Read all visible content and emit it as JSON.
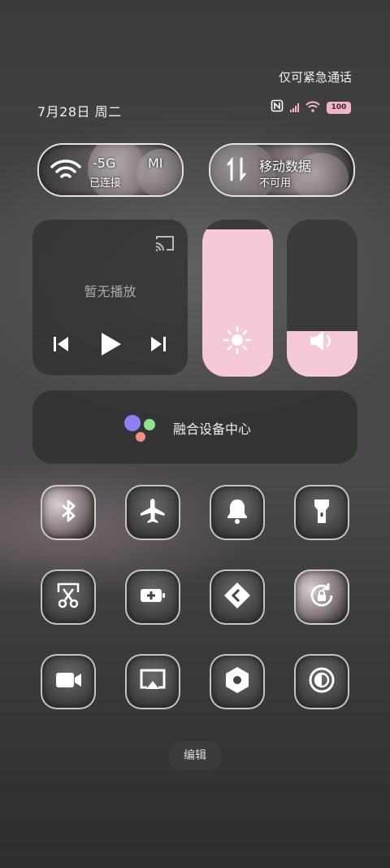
{
  "status_bar": {
    "emergency_text": "仅可紧急通话",
    "date_text": "7月28日 周二",
    "battery_level": "100",
    "accent_color": "#f2b4c8"
  },
  "connectivity": {
    "wifi": {
      "title": "-5G",
      "status": "已连接",
      "extra": "MI",
      "icon": "wifi-icon"
    },
    "mobile_data": {
      "title": "移动数据",
      "status": "不可用",
      "icon": "mobile-data-icon"
    }
  },
  "media": {
    "title": "暂无播放"
  },
  "sliders": {
    "brightness": {
      "level": 0.94,
      "icon": "brightness-icon",
      "color": "#f5c9d8"
    },
    "volume": {
      "level": 0.29,
      "icon": "volume-icon",
      "color": "#f5c9d8"
    }
  },
  "device_hub": {
    "label": "融合设备中心"
  },
  "toggles": [
    {
      "id": "bluetooth",
      "icon": "bluetooth-icon"
    },
    {
      "id": "airplane",
      "icon": "airplane-icon"
    },
    {
      "id": "alert",
      "icon": "bell-icon"
    },
    {
      "id": "flashlight",
      "icon": "flashlight-icon"
    },
    {
      "id": "screenshot",
      "icon": "screenshot-scissors-icon"
    },
    {
      "id": "battery-saver",
      "icon": "battery-plus-icon"
    },
    {
      "id": "vpn",
      "icon": "code-diamond-icon"
    },
    {
      "id": "rotation-lock",
      "icon": "rotation-lock-icon"
    },
    {
      "id": "screen-record",
      "icon": "video-camera-icon"
    },
    {
      "id": "cast",
      "icon": "screen-cast-icon"
    },
    {
      "id": "settings",
      "icon": "hexagon-gear-icon"
    },
    {
      "id": "dark-mode",
      "icon": "dark-mode-icon"
    }
  ],
  "edit_button": {
    "label": "编辑"
  }
}
